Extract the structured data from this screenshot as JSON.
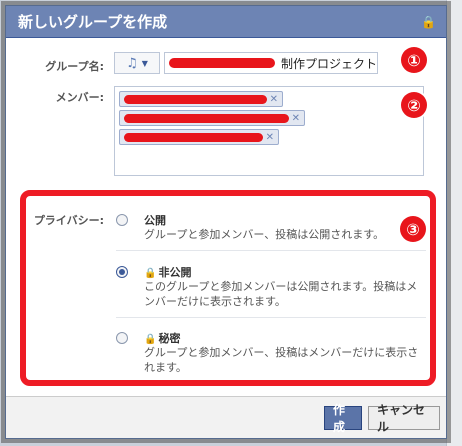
{
  "dialog": {
    "title": "新しいグループを作成"
  },
  "group_name": {
    "label": "グループ名:",
    "icon": "music-note-icon",
    "value_suffix": "制作プロジェクト"
  },
  "members": {
    "label": "メンバー:"
  },
  "privacy": {
    "label": "プライバシー:",
    "options": [
      {
        "title": "公開",
        "description": "グループと参加メンバー、投稿は公開されます。",
        "selected": false
      },
      {
        "title": "非公開",
        "description": "このグループと参加メンバーは公開されます。投稿はメンバーだけに表示されます。",
        "selected": true
      },
      {
        "title": "秘密",
        "description": "グループと参加メンバー、投稿はメンバーだけに表示されます。",
        "selected": false
      }
    ]
  },
  "annotations": {
    "one": "①",
    "two": "②",
    "three": "③"
  },
  "buttons": {
    "create": "作成",
    "cancel": "キャンセル"
  },
  "colors": {
    "header": "#6d84b4",
    "highlight": "#ee1c25",
    "primary_button": "#5b74a8"
  }
}
